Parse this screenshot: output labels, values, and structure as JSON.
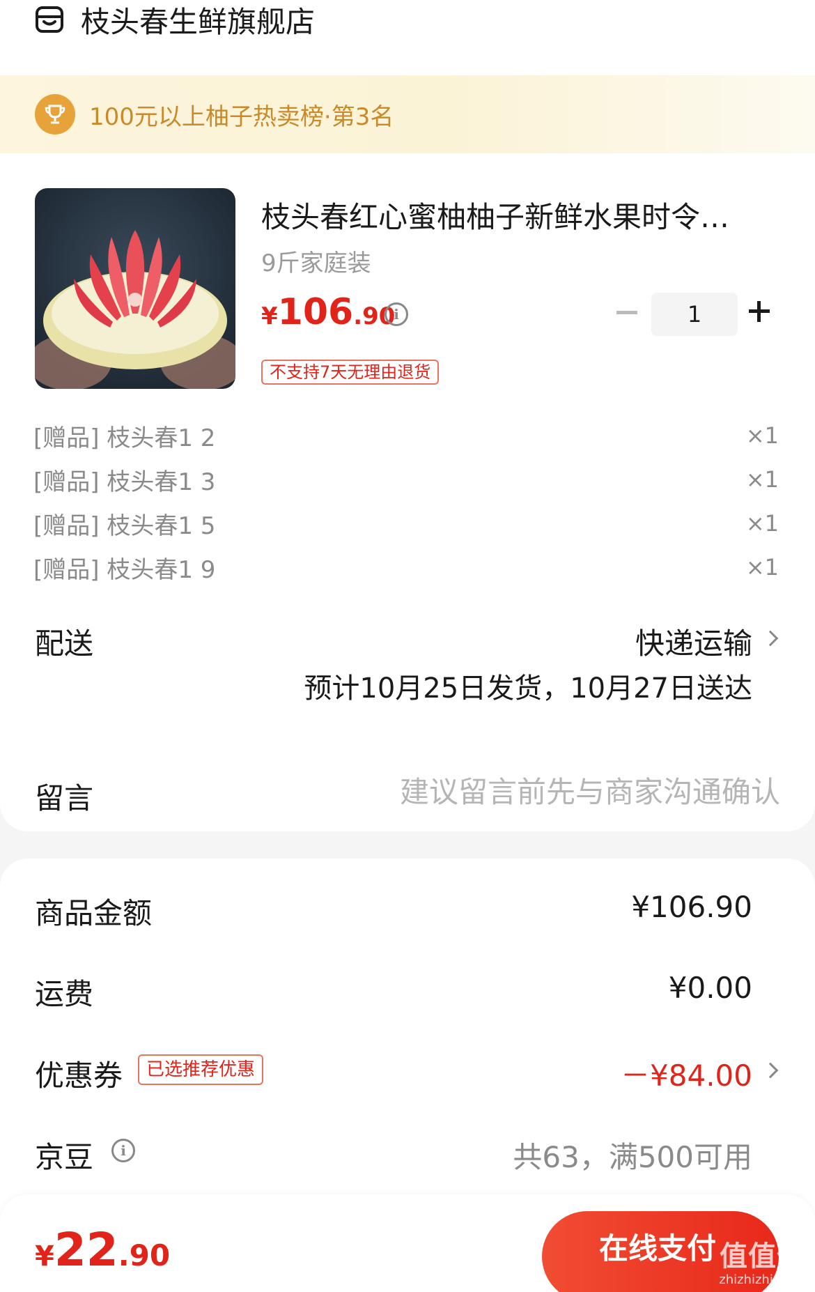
{
  "shop": {
    "name": "枝头春生鲜旗舰店",
    "icon": "shop-icon"
  },
  "rank": {
    "text": "100元以上柚子热卖榜·第3名",
    "icon": "trophy-icon"
  },
  "product": {
    "title": "枝头春红心蜜柚柚子新鲜水果时令…",
    "spec": "9斤家庭装",
    "price_symbol": "¥",
    "price_int": "106",
    "price_dec": ".90",
    "return_tag": "不支持7天无理由退货",
    "quantity": "1"
  },
  "gifts": [
    {
      "name": "[赠品] 枝头春1 2",
      "qty": "×1"
    },
    {
      "name": "[赠品] 枝头春1 3",
      "qty": "×1"
    },
    {
      "name": "[赠品] 枝头春1 5",
      "qty": "×1"
    },
    {
      "name": "[赠品] 枝头春1 9",
      "qty": "×1"
    }
  ],
  "delivery": {
    "label": "配送",
    "method": "快递运输",
    "eta": "预计10月25日发货，10月27日送达"
  },
  "message": {
    "label": "留言",
    "placeholder": "建议留言前先与商家沟通确认"
  },
  "summary": {
    "goods_label": "商品金额",
    "goods_value": "¥106.90",
    "shipping_label": "运费",
    "shipping_value": "¥0.00",
    "coupon_label": "优惠券",
    "coupon_tag": "已选推荐优惠",
    "coupon_value": "－¥84.00",
    "beans_label": "京豆",
    "beans_value": "共63，满500可用"
  },
  "footer": {
    "total_symbol": "¥",
    "total_int": "22",
    "total_dec": ".90",
    "pay_label": "在线支付",
    "watermark": "值值值",
    "watermark_sub": "zhizhizhi.com"
  },
  "colors": {
    "accent": "#e2231a",
    "gold": "#c98a2a",
    "banner_bg": "#fdf5dc"
  }
}
